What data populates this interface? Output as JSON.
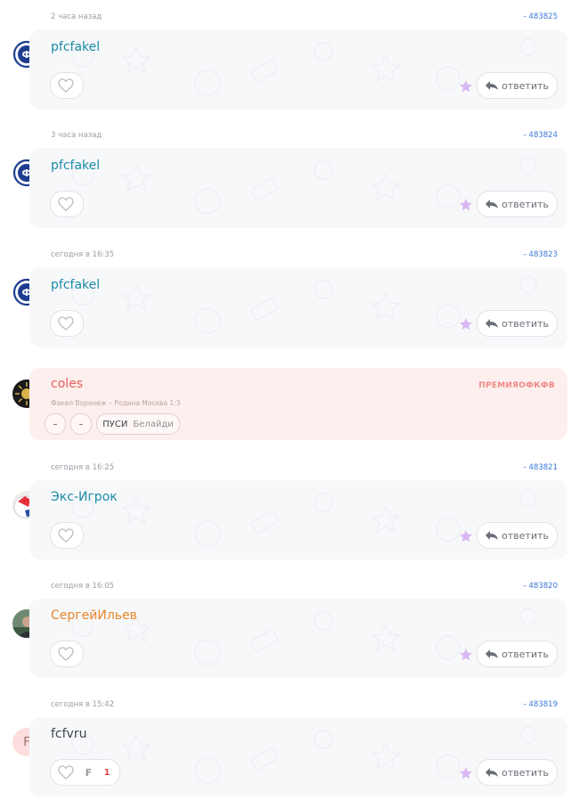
{
  "comments": [
    {
      "time": "2 часа назад",
      "id": "483825",
      "author": "pfcfakel",
      "author_color": "#1b8ca6",
      "reply_label": "ответить"
    },
    {
      "time": "3 часа назад",
      "id": "483824",
      "author": "pfcfakel",
      "author_color": "#1b8ca6",
      "reply_label": "ответить"
    },
    {
      "time": "сегодня в 16:35",
      "id": "483823",
      "author": "pfcfakel",
      "author_color": "#1b8ca6",
      "reply_label": "ответить"
    },
    {
      "time": "сегодня в 16:25",
      "id": "483821",
      "author": "Экс-Игрок",
      "author_color": "#1b8ca6",
      "reply_label": "ответить"
    },
    {
      "time": "сегодня в 16:05",
      "id": "483820",
      "author": "СергейИльев",
      "author_color": "#e8852a",
      "reply_label": "ответить"
    },
    {
      "time": "сегодня в 15:42",
      "id": "483819",
      "author": "fcfvru",
      "author_color": "#40454d",
      "reply_label": "ответить",
      "avatar_letter": "F",
      "reaction_count": "1"
    }
  ],
  "premium": {
    "author": "coles",
    "author_color": "#e5605b",
    "tag": "ПРЕМИЯОФКФВ",
    "match": "Факел Воронеж – Родина Москва 1:3",
    "pill1": "–",
    "pill2": "–",
    "pill3_main": "ПУСИ",
    "pill3_sub": "Белайди"
  },
  "colors": {
    "link": "#3a78d6",
    "star": "#d9b8f2",
    "card_bg": "#f7f8fa",
    "premium_bg": "#fdefed"
  },
  "icons": [
    "heart-icon",
    "star-icon",
    "reply-arrow-icon",
    "fakel-logo",
    "sun-avatar",
    "ball-avatar",
    "photo-avatar"
  ]
}
